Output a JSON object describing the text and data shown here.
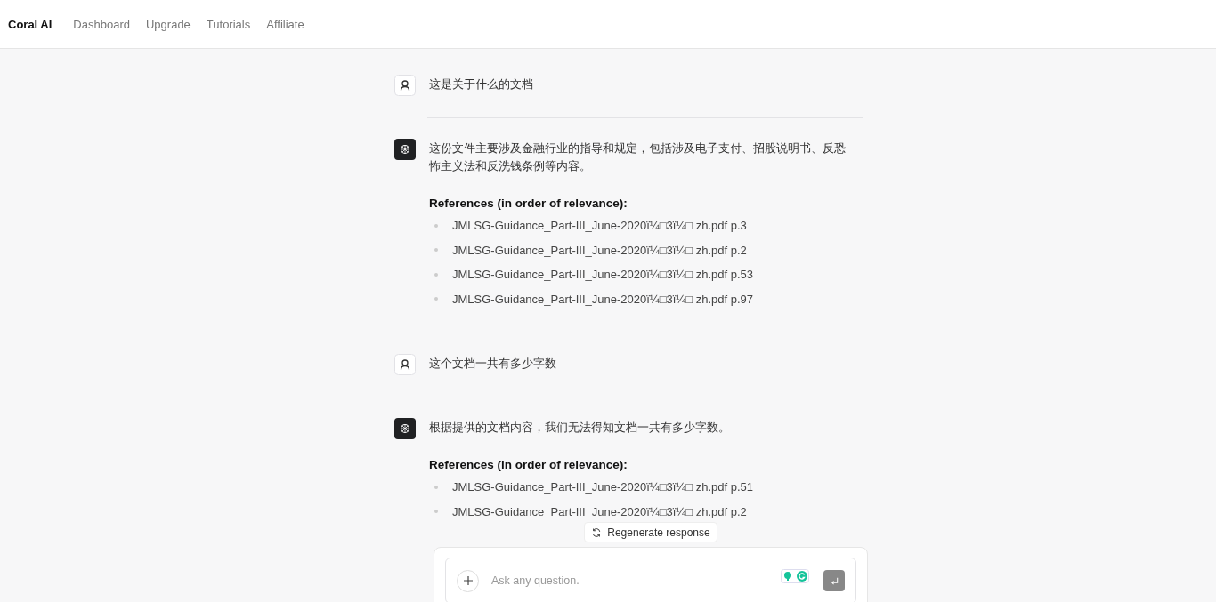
{
  "nav": {
    "brand": "Coral AI",
    "links": [
      {
        "label": "Dashboard"
      },
      {
        "label": "Upgrade"
      },
      {
        "label": "Tutorials"
      },
      {
        "label": "Affiliate"
      }
    ]
  },
  "messages": [
    {
      "kind": "user",
      "text": "这是关于什么的文档"
    },
    {
      "kind": "assistant",
      "text": "这份文件主要涉及金融行业的指导和规定，包括涉及电子支付、招股说明书、反恐怖主义法和反洗钱条例等内容。",
      "references_heading": "References (in order of relevance):",
      "references": [
        "JMLSG-Guidance_Part-III_June-2020ï¼□3ï¼□ zh.pdf p.3",
        "JMLSG-Guidance_Part-III_June-2020ï¼□3ï¼□ zh.pdf p.2",
        "JMLSG-Guidance_Part-III_June-2020ï¼□3ï¼□ zh.pdf p.53",
        "JMLSG-Guidance_Part-III_June-2020ï¼□3ï¼□ zh.pdf p.97"
      ]
    },
    {
      "kind": "user",
      "text": "这个文档一共有多少字数"
    },
    {
      "kind": "assistant",
      "text": "根据提供的文档内容，我们无法得知文档一共有多少字数。",
      "references_heading": "References (in order of relevance):",
      "references": [
        "JMLSG-Guidance_Part-III_June-2020ï¼□3ï¼□ zh.pdf p.51",
        "JMLSG-Guidance_Part-III_June-2020ï¼□3ï¼□ zh.pdf p.2"
      ]
    }
  ],
  "regenerate_button": "Regenerate response",
  "composer": {
    "placeholder": "Ask any question."
  }
}
